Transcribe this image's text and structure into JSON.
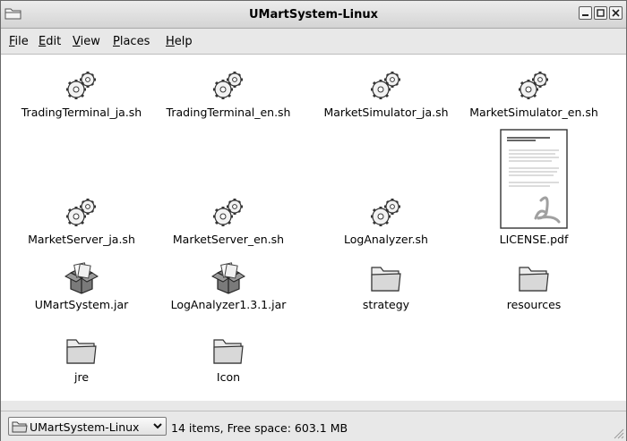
{
  "window": {
    "title": "UMartSystem-Linux"
  },
  "menu": [
    "File",
    "Edit",
    "View",
    "Places",
    "Help"
  ],
  "files": [
    {
      "name": "TradingTerminal_ja.sh",
      "icon": "gears-icon"
    },
    {
      "name": "TradingTerminal_en.sh",
      "icon": "gears-icon"
    },
    {
      "name": "MarketSimulator_ja.sh",
      "icon": "gears-icon"
    },
    {
      "name": "MarketSimulator_en.sh",
      "icon": "gears-icon"
    },
    {
      "name": "MarketServer_ja.sh",
      "icon": "gears-icon"
    },
    {
      "name": "MarketServer_en.sh",
      "icon": "gears-icon"
    },
    {
      "name": "LogAnalyzer.sh",
      "icon": "gears-icon"
    },
    {
      "name": "LICENSE.pdf",
      "icon": "pdf-document-icon"
    },
    {
      "name": "UMartSystem.jar",
      "icon": "jar-package-icon"
    },
    {
      "name": "LogAnalyzer1.3.1.jar",
      "icon": "jar-package-icon"
    },
    {
      "name": "strategy",
      "icon": "folder-icon"
    },
    {
      "name": "resources",
      "icon": "folder-icon"
    },
    {
      "name": "jre",
      "icon": "folder-icon"
    },
    {
      "name": "Icon",
      "icon": "folder-icon"
    }
  ],
  "statusbar": {
    "location": "UMartSystem-Linux",
    "status": "14 items, Free space: 603.1 MB"
  }
}
